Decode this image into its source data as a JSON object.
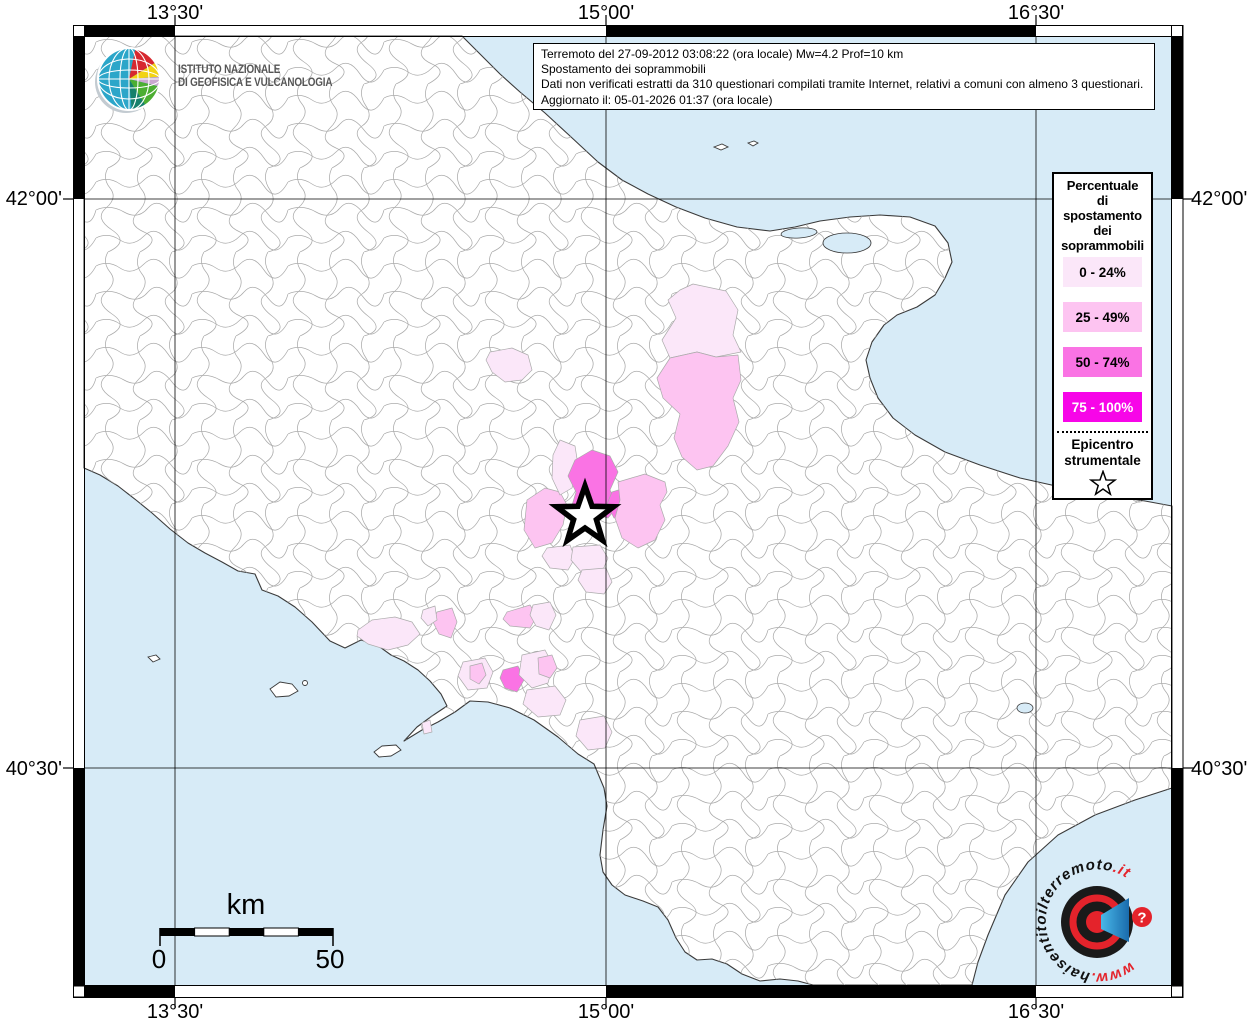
{
  "info_box": {
    "lines": [
      "Terremoto del 27-09-2012 03:08:22 (ora locale) Mw=4.2 Prof=10 km",
      "Spostamento dei soprammobili",
      "Dati non verificati estratti da 310 questionari compilati tramite Internet, relativi a comuni con almeno 3 questionari.",
      "Aggiornato il: 05-01-2026 01:37 (ora locale)"
    ]
  },
  "ingv": {
    "name_line1": "ISTITUTO NAZIONALE",
    "name_line2": "DI GEOFISICA E VULCANOLOGIA"
  },
  "legend": {
    "title_lines": [
      "Percentuale",
      "di",
      "spostamento",
      "dei",
      "soprammobili"
    ],
    "classes": [
      {
        "label": "0 - 24%",
        "color": "#FBE7F9"
      },
      {
        "label": "25 - 49%",
        "color": "#FDC4F1"
      },
      {
        "label": "50 - 74%",
        "color": "#FA73E4"
      },
      {
        "label": "75 - 100%",
        "color": "#F705E8"
      }
    ],
    "epicenter": {
      "line1": "Epicentro",
      "line2": "strumentale",
      "symbol": "star-icon"
    }
  },
  "axes": {
    "meridians": [
      "13°30'",
      "15°00'",
      "16°30'"
    ],
    "parallels": [
      "42°00'",
      "40°30'"
    ]
  },
  "scalebar": {
    "unit": "km",
    "from": "0",
    "to": "50"
  },
  "site_logo": {
    "url_prefix": "www.",
    "url_middle": "haisentitoilterremoto",
    "url_suffix": ".it",
    "question_mark": "?"
  },
  "map": {
    "sea_color": "#D7EBF7",
    "land_color": "#FFFFFF",
    "municipality_border_color": "#ABABAB",
    "epicenter_symbol": "star-icon"
  }
}
